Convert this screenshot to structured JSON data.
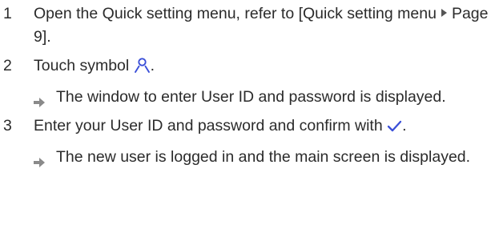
{
  "steps": [
    {
      "number": "1",
      "text_before_link": "Open the Quick setting menu, refer to ",
      "link_open": "[",
      "link_title": "Quick setting menu",
      "link_page": "Page 9",
      "link_close": "]",
      "text_after_link": "."
    },
    {
      "number": "2",
      "text_before_icon": "Touch symbol ",
      "icon": "user-icon",
      "text_after_icon": ".",
      "result": "The window to enter User ID and password is displayed."
    },
    {
      "number": "3",
      "text_before_icon": "Enter your User ID and password and confirm with ",
      "icon": "checkmark-icon",
      "text_after_icon": ".",
      "result": "The new user is logged in and the main screen is displayed."
    }
  ],
  "colors": {
    "text": "#2b2b2b",
    "icon_accent": "#3a4fd8",
    "arrow": "#8a8a8a"
  }
}
